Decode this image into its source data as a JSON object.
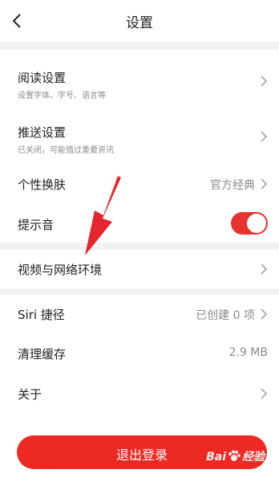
{
  "header": {
    "title": "设置"
  },
  "settings": {
    "reading": {
      "label": "阅读设置",
      "sub": "设置字体、字号、语言等"
    },
    "push": {
      "label": "推送设置",
      "sub": "已关闭，可能错过重要资讯"
    },
    "skin": {
      "label": "个性换肤",
      "value": "官方经典"
    },
    "sound": {
      "label": "提示音",
      "enabled": true
    },
    "video": {
      "label": "视频与网络环境"
    },
    "siri": {
      "label": "Siri 捷径",
      "value": "已创建 0 项"
    },
    "cache": {
      "label": "清理缓存",
      "value": "2.9 MB"
    },
    "about": {
      "label": "关于"
    }
  },
  "footer": {
    "logout_label": "退出登录"
  },
  "watermark": {
    "text_left": "Bai",
    "text_right": "经验"
  },
  "colors": {
    "accent": "#e8322f",
    "annotation_arrow": "#e5262c"
  }
}
